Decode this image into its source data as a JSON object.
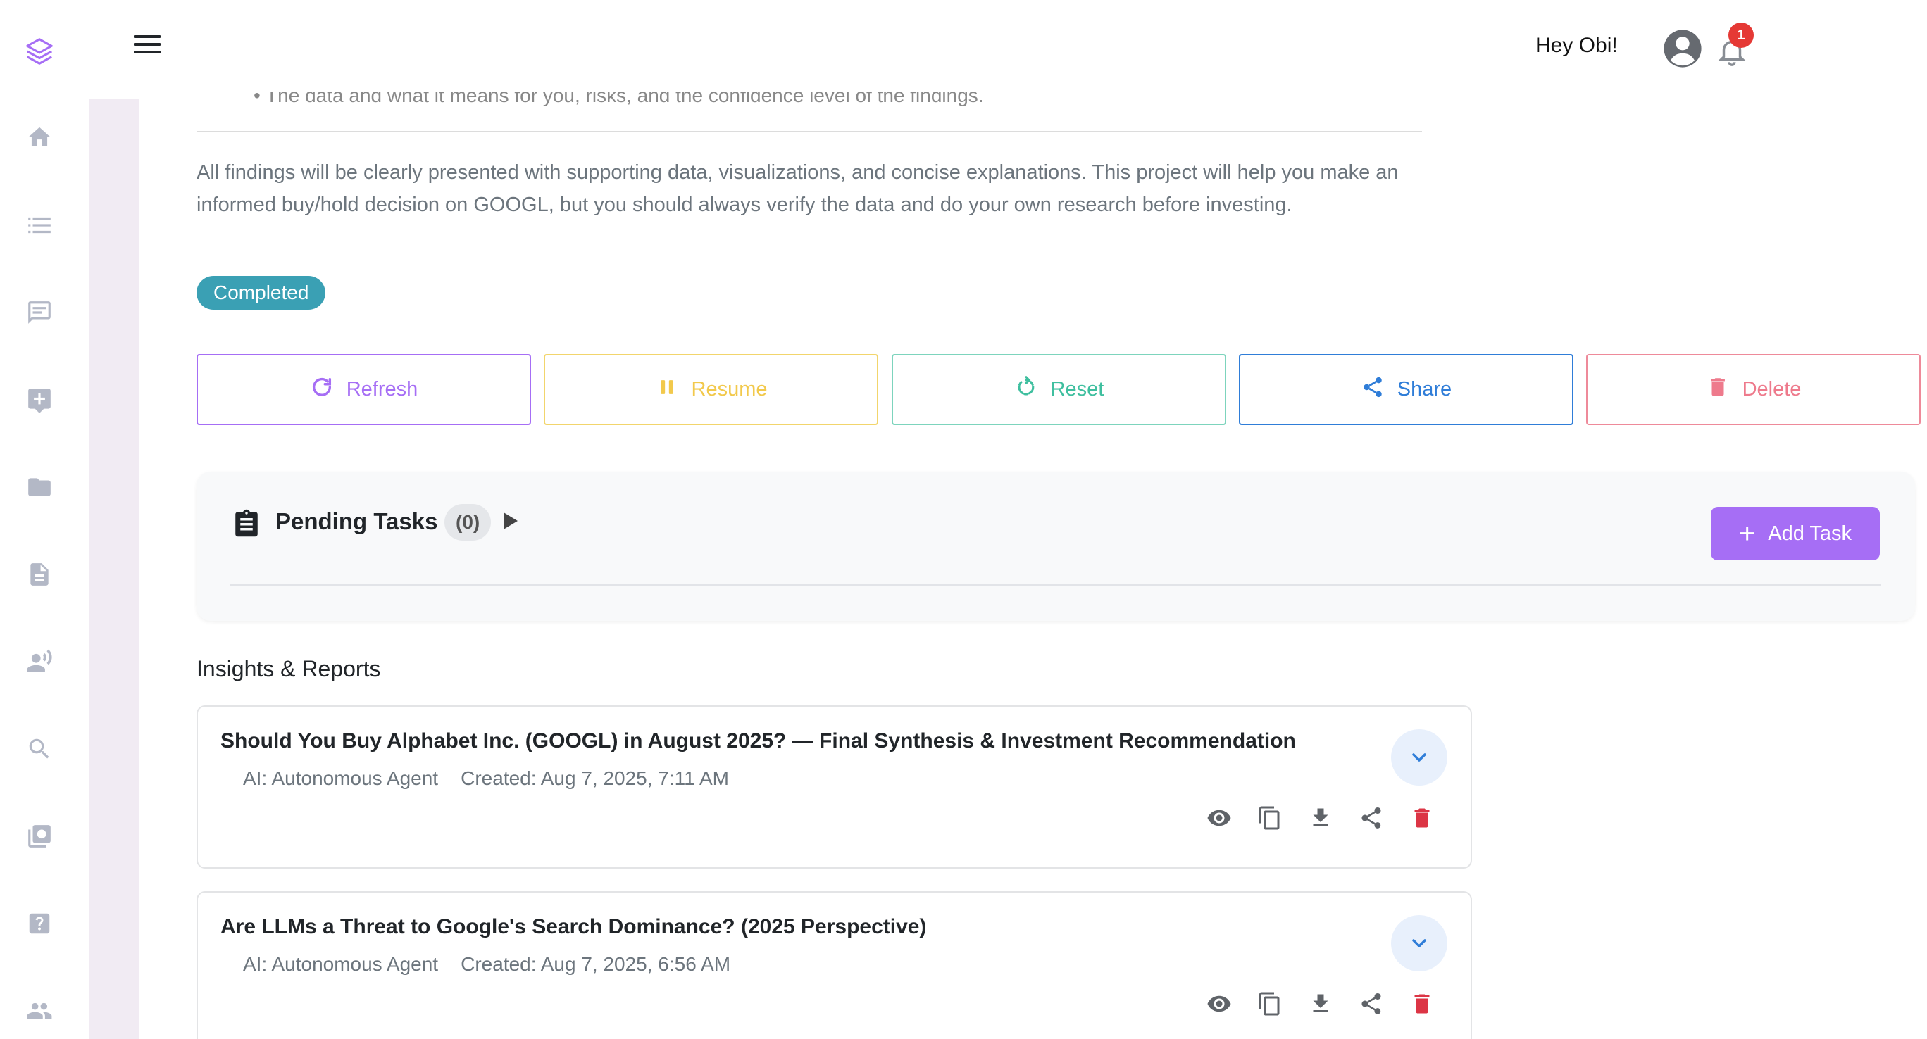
{
  "header": {
    "greeting": "Hey Obi!",
    "notification_count": "1"
  },
  "sidebar": {
    "items": [
      {
        "name": "home"
      },
      {
        "name": "list"
      },
      {
        "name": "chat"
      },
      {
        "name": "add-comment"
      },
      {
        "name": "folder"
      },
      {
        "name": "document"
      },
      {
        "name": "voice"
      },
      {
        "name": "search"
      },
      {
        "name": "media"
      },
      {
        "name": "help"
      },
      {
        "name": "team"
      }
    ]
  },
  "content": {
    "cut_text": "• The data and what it means for you, risks, and the confidence level of the findings.",
    "summary": "All findings will be clearly presented with supporting data, visualizations, and concise explanations. This project will help you make an informed buy/hold decision on GOOGL, but you should always verify the data and do your own research before investing.",
    "status": "Completed"
  },
  "actions": {
    "refresh": "Refresh",
    "resume": "Resume",
    "reset": "Reset",
    "share": "Share",
    "delete": "Delete"
  },
  "tasks": {
    "title": "Pending Tasks",
    "count": "(0)",
    "add_label": "Add Task"
  },
  "reports": {
    "section_title": "Insights & Reports",
    "items": [
      {
        "title": "Should You Buy Alphabet Inc. (GOOGL) in August 2025? — Final Synthesis & Investment Recommendation",
        "author": "AI: Autonomous Agent",
        "created": "Created: Aug 7, 2025, 7:11 AM"
      },
      {
        "title": "Are LLMs a Threat to Google's Search Dominance? (2025 Perspective)",
        "author": "AI: Autonomous Agent",
        "created": "Created: Aug 7, 2025, 6:56 AM"
      }
    ]
  },
  "colors": {
    "accent_purple": "#a66ef5",
    "refresh": "#a66ef5",
    "resume": "#f2c94c",
    "reset": "#3fbf9f",
    "share": "#2f7dd8",
    "delete": "#ee7a8c",
    "status_badge": "#3aa0b4"
  }
}
